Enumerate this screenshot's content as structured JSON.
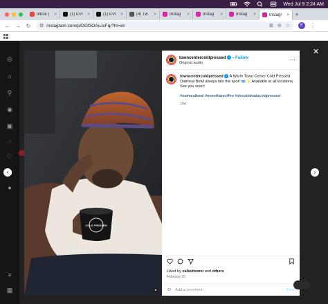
{
  "menubar": {
    "datetime": "Wed Jul 9  2:24 AM"
  },
  "tabs": [
    {
      "title": "Inbox (",
      "fav": "gmail",
      "color": "#ea4335"
    },
    {
      "title": "(1) EVI",
      "fav": "x",
      "color": "#111111"
    },
    {
      "title": "(1) EVI",
      "fav": "x",
      "color": "#111111"
    },
    {
      "title": "(4) Tw",
      "fav": "tw",
      "color": "#555555"
    },
    {
      "title": "Instag",
      "fav": "ig",
      "color": "#d6249f"
    },
    {
      "title": "Instag",
      "fav": "ig",
      "color": "#d6249f"
    },
    {
      "title": "Instag",
      "fav": "ig",
      "color": "#d6249f"
    },
    {
      "title": "Instagr",
      "fav": "ig",
      "color": "#d6249f"
    }
  ],
  "address": {
    "url": "instagram.com/p/DGf3OAuJcFq/?hl=en"
  },
  "profile_initial": "E",
  "post": {
    "username": "towncentercoldpressed",
    "follow_label": "Follow",
    "audio": "Original audio",
    "caption_text": "A Warm Town Center Cold Pressed Oatmeal Bowl always hits the spot! 🥣✨ Available at all locations. See you soon!",
    "hashtags": "#oatmealbowl #morethancoffee #shouldahadacoldpressed",
    "time": "19w",
    "likes_prefix": "Liked by ",
    "likes_user": "cafecitoxco",
    "likes_and": " and ",
    "likes_others": "others",
    "date": "February 25",
    "comment_placeholder": "Add a comment...",
    "post_label": "Post",
    "cup_text": "COLD PRESSED"
  }
}
